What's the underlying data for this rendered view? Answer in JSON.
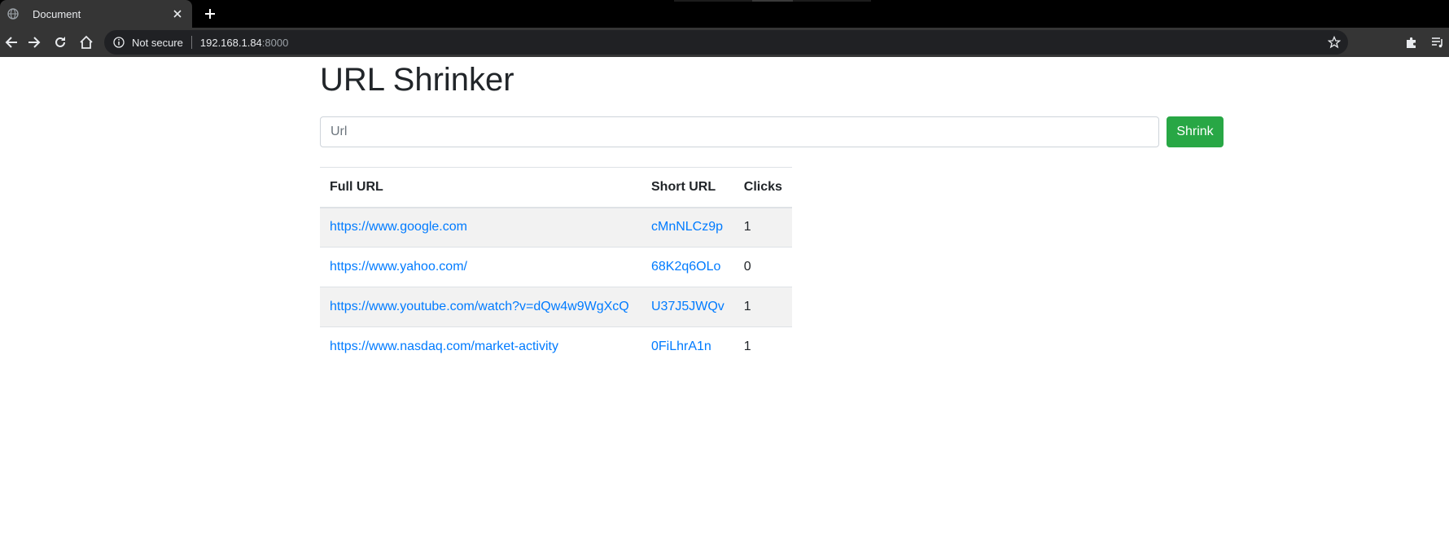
{
  "browser": {
    "tab_title": "Document",
    "address": {
      "security_label": "Not secure",
      "host": "192.168.1.84",
      "port": ":8000"
    }
  },
  "page": {
    "heading": "URL Shrinker",
    "form": {
      "input_placeholder": "Url",
      "input_value": "",
      "submit_label": "Shrink"
    },
    "table": {
      "headers": {
        "full_url": "Full URL",
        "short_url": "Short URL",
        "clicks": "Clicks"
      },
      "rows": [
        {
          "full_url": "https://www.google.com",
          "short_url": "cMnNLCz9p",
          "clicks": "1"
        },
        {
          "full_url": "https://www.yahoo.com/",
          "short_url": "68K2q6OLo",
          "clicks": "0"
        },
        {
          "full_url": "https://www.youtube.com/watch?v=dQw4w9WgXcQ",
          "short_url": "U37J5JWQv",
          "clicks": "1"
        },
        {
          "full_url": "https://www.nasdaq.com/market-activity",
          "short_url": "0FiLhrA1n",
          "clicks": "1"
        }
      ]
    }
  },
  "colors": {
    "link": "#007bff",
    "button_success": "#28a745",
    "stripe": "#f2f2f2",
    "text": "#212529"
  }
}
